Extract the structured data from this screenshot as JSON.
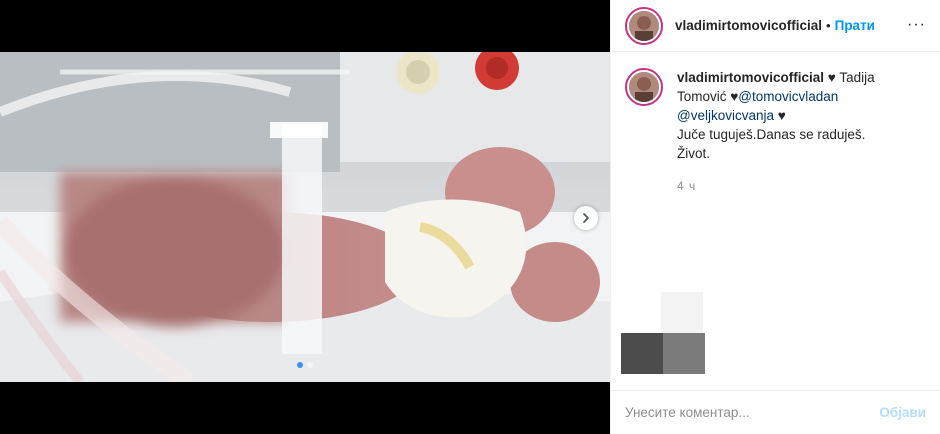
{
  "post": {
    "username": "vladimirtomovicofficial",
    "separator": "•",
    "follow_label": "Прати",
    "more_label": "···",
    "caption": {
      "username": "vladimirtomovicofficial",
      "part1": " ♥ Tadija Tomović ♥",
      "mention1": "@tomovicvladan",
      "mention2": "@veljkovicvanja",
      "part2": " ♥",
      "line2": "Juče tuguješ.Danas se raduješ.",
      "line3": "Život."
    },
    "time": "4 ч",
    "carousel": {
      "current": 1,
      "total": 2
    },
    "comment": {
      "placeholder": "Унесите коментар...",
      "post_label": "Објави"
    }
  },
  "colors": {
    "follow": "#0095f6",
    "mention": "#00376b",
    "post_disabled": "#b2dffc",
    "active_dot": "#3b8ff7"
  },
  "icons": [
    "chevron-right-icon",
    "more-options-icon"
  ]
}
